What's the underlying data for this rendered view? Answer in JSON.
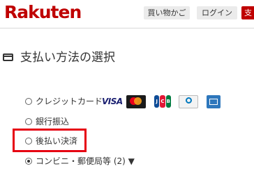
{
  "header": {
    "logo": "Rakuten",
    "cart_label": "買い物かご",
    "login_label": "ログイン",
    "pay_label": "支"
  },
  "section": {
    "title": "支払い方法の選択"
  },
  "payment_options": [
    {
      "label": "クレジットカード",
      "selected": false
    },
    {
      "label": "銀行振込",
      "selected": false
    },
    {
      "label": "後払い決済",
      "selected": false
    },
    {
      "label": "コンビニ・郵便局等 (2) ▼",
      "selected": true
    }
  ],
  "card_brands": {
    "visa": "VISA",
    "jcb_j": "J",
    "jcb_c": "C",
    "jcb_b": "B"
  },
  "colors": {
    "brand": "#bf0000",
    "highlight": "#e60012"
  }
}
